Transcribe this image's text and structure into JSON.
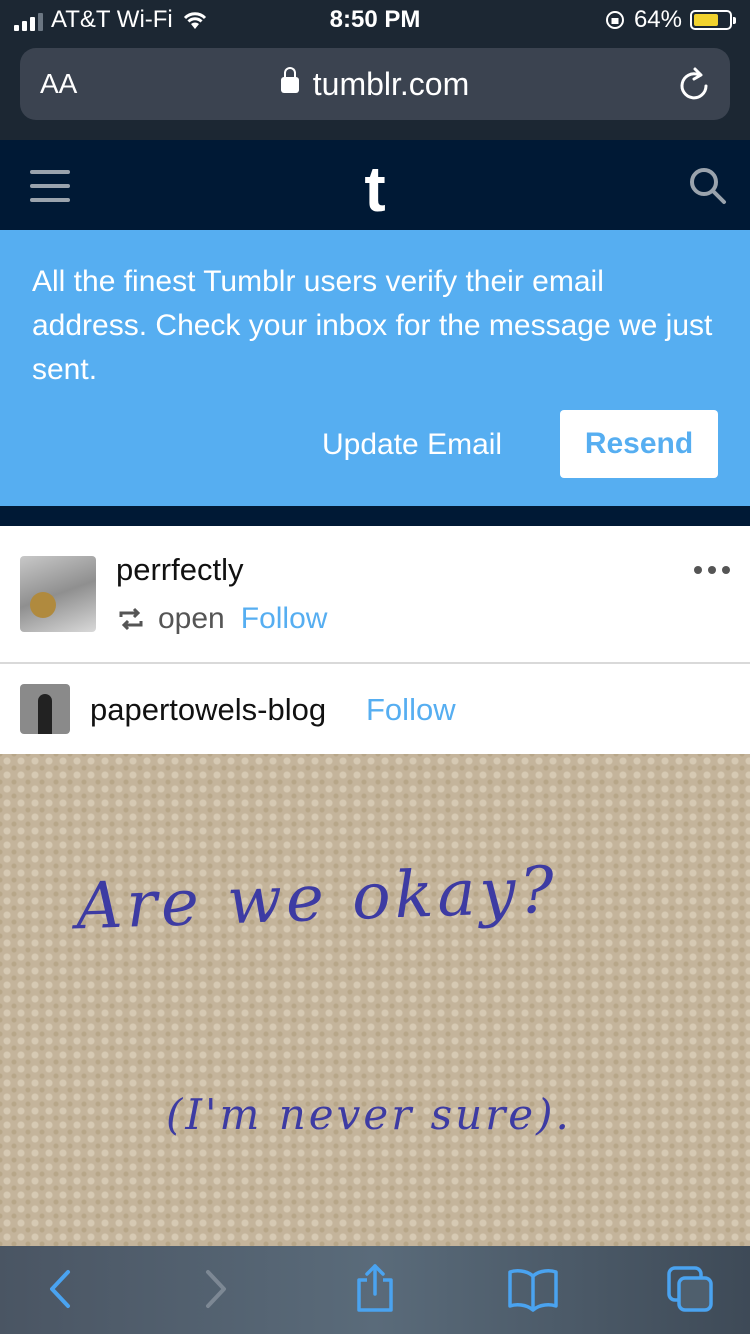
{
  "status_bar": {
    "carrier": "AT&T Wi-Fi",
    "time": "8:50 PM",
    "battery": "64%"
  },
  "browser": {
    "text_size_label": "AA",
    "domain": "tumblr.com"
  },
  "banner": {
    "message": "All the finest Tumblr users verify their email address. Check your inbox for the message we just sent.",
    "update_email": "Update Email",
    "resend": "Resend"
  },
  "post": {
    "username": "perrfectly",
    "reblog_text": "open",
    "follow": "Follow",
    "source_name": "papertowels-blog",
    "source_follow": "Follow",
    "image_text_line1": "Are we okay?",
    "image_text_line2": "(I'm never sure)."
  },
  "colors": {
    "tumblr_navy": "#001935",
    "accent_blue": "#56aef1",
    "browser_chrome": "#1c2733"
  }
}
